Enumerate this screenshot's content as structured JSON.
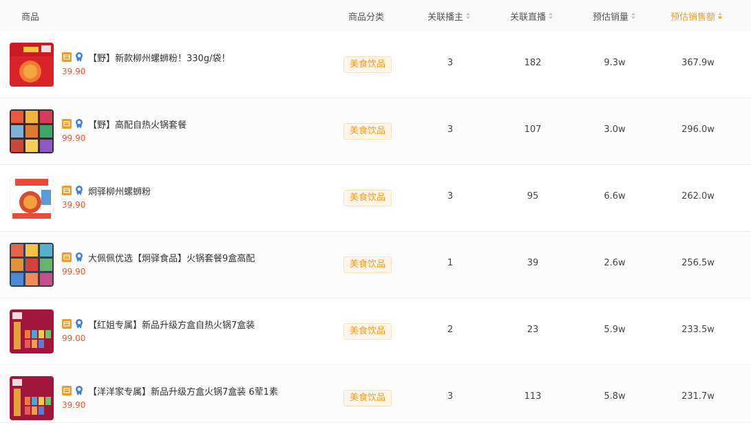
{
  "header": {
    "product": "商品",
    "category": "商品分类",
    "anchors": "关联播主",
    "lives": "关联直播",
    "sales": "预估销量",
    "revenue": "预估销售额"
  },
  "rows": [
    {
      "title": "【野】新款柳州螺蛳粉！330g/袋！",
      "price": "39.90",
      "category": "美食饮品",
      "anchors": "3",
      "lives": "182",
      "sales": "9.3w",
      "revenue": "367.9w"
    },
    {
      "title": "【野】高配自热火锅套餐",
      "price": "99.90",
      "category": "美食饮品",
      "anchors": "3",
      "lives": "107",
      "sales": "3.0w",
      "revenue": "296.0w"
    },
    {
      "title": "炯驿柳州螺蛳粉",
      "price": "39.90",
      "category": "美食饮品",
      "anchors": "3",
      "lives": "95",
      "sales": "6.6w",
      "revenue": "262.0w"
    },
    {
      "title": "大佩佩优选【炯驿食品】火锅套餐9盒高配",
      "price": "99.90",
      "category": "美食饮品",
      "anchors": "1",
      "lives": "39",
      "sales": "2.6w",
      "revenue": "256.5w"
    },
    {
      "title": "【红姐专属】新品升级方盒自热火锅7盒装",
      "price": "99.00",
      "category": "美食饮品",
      "anchors": "2",
      "lives": "23",
      "sales": "5.9w",
      "revenue": "233.5w"
    },
    {
      "title": "【洋洋家专属】新品升级方盒火锅7盒装 6荤1素",
      "price": "39.90",
      "category": "美食饮品",
      "anchors": "3",
      "lives": "113",
      "sales": "5.8w",
      "revenue": "231.7w"
    }
  ],
  "colors": {
    "accent": "#f29b23",
    "price": "#e4572e",
    "tag_bg": "#fff5e8"
  },
  "icons": [
    "shop-icon",
    "award-icon",
    "sort-icon"
  ]
}
